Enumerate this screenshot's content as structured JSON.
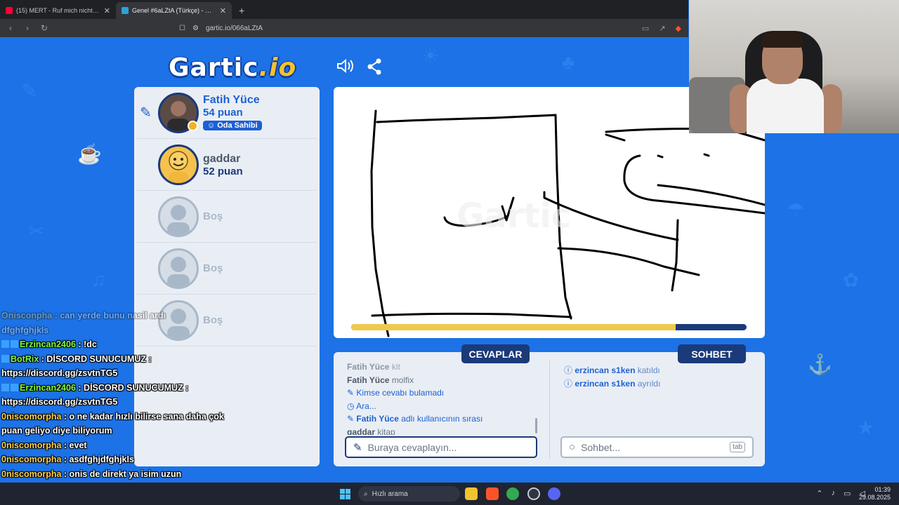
{
  "browser": {
    "tabs": [
      {
        "title": "(15) MERT - Ruf mich nicht an (p",
        "active": false,
        "color": "#ff0033"
      },
      {
        "title": "Genel #6aLZtA (Türkçe) - Gartic.i",
        "active": true,
        "color": "#29a3d8"
      }
    ],
    "new_tab": "+",
    "url": "gartic.io/066aLZtA"
  },
  "logo": {
    "main": "Gartic",
    "suffix": ".io"
  },
  "players": [
    {
      "name": "Fatih Yüce",
      "score": "54 puan",
      "badge": "Oda Sahibi",
      "drawing": true
    },
    {
      "name": "gaddar",
      "score": "52 puan"
    },
    {
      "empty_label": "Boş"
    },
    {
      "empty_label": "Boş"
    },
    {
      "empty_label": "Boş"
    }
  ],
  "timer_progress": 0.82,
  "tabs": {
    "answers": "CEVAPLAR",
    "chat": "SOHBET"
  },
  "answers": [
    {
      "user": "Fatih Yüce",
      "text": "kit"
    },
    {
      "user": "Fatih Yüce",
      "text": "molfix"
    },
    {
      "system": "Kimse cevabı bulamadı"
    },
    {
      "system": "Ara..."
    },
    {
      "user_sys": "Fatih Yüce",
      "text": "adlı kullanıcının sırası"
    },
    {
      "user": "gaddar",
      "text": "kitap"
    }
  ],
  "chat": [
    {
      "user": "erzincan s1ken",
      "text": "katıldı"
    },
    {
      "user": "erzincan s1ken",
      "text": "ayrıldı"
    }
  ],
  "inputs": {
    "answer_placeholder": "Buraya cevaplayın...",
    "chat_placeholder": "Sohbet...",
    "chat_key": "tab"
  },
  "stream_chat": [
    {
      "user": "Onisconpha",
      "text": ": can yerde bunu nasil ardı",
      "fade": true
    },
    {
      "user": "",
      "text": "dfghfghjkls",
      "fade": true
    },
    {
      "user": "Erzincan2406",
      "text": ": !dc"
    },
    {
      "user": "BotRix",
      "text": ": DİSCORD SUNUCUMUZ :"
    },
    {
      "user": "",
      "text": "https://discord.gg/zsvtnTG5"
    },
    {
      "user": "Erzincan2406",
      "text": ": DİSCORD SUNUCUMUZ :"
    },
    {
      "user": "",
      "text": "https://discord.gg/zsvtnTG5"
    },
    {
      "user": "0niscomorpha",
      "text": ": o ne kadar hızlı bilirse sana daha çok"
    },
    {
      "user": "",
      "text": "puan geliyo diye biliyorum"
    },
    {
      "user": "0niscomorpha",
      "text": ": evet"
    },
    {
      "user": "0niscomorpha",
      "text": ": asdfghjdfghjkls"
    },
    {
      "user": "0niscomorpha",
      "text": ": onis de direkt ya isim uzun"
    }
  ],
  "taskbar": {
    "search": "Hızlı arama",
    "time": "01:39",
    "date": "29.08.2025"
  }
}
